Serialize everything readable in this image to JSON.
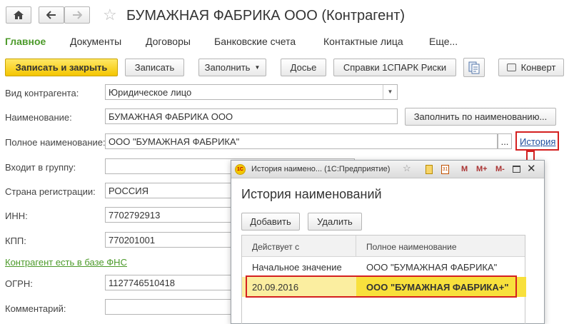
{
  "titlebar": {
    "title": "БУМАЖНАЯ ФАБРИКА ООО (Контрагент)"
  },
  "menu": {
    "items": [
      "Главное",
      "Документы",
      "Договоры",
      "Банковские счета",
      "Контактные лица",
      "Еще..."
    ]
  },
  "toolbar": {
    "save_close": "Записать и закрыть",
    "save": "Записать",
    "fill": "Заполнить",
    "dossier": "Досье",
    "spark": "Справки 1СПАРК Риски",
    "envelope": "Конверт"
  },
  "form": {
    "type_label": "Вид контрагента:",
    "type_value": "Юридическое лицо",
    "name_label": "Наименование:",
    "name_value": "БУМАЖНАЯ ФАБРИКА ООО",
    "fill_by_name": "Заполнить по наименованию...",
    "full_name_label": "Полное наименование:",
    "full_name_value": "ООО \"БУМАЖНАЯ ФАБРИКА\"",
    "ellipsis": "...",
    "history_link": "История",
    "group_label": "Входит в группу:",
    "group_value": "",
    "country_label": "Страна регистрации:",
    "country_value": "РОССИЯ",
    "inn_label": "ИНН:",
    "inn_value": "7702792913",
    "kpp_label": "КПП:",
    "kpp_value": "770201001",
    "fns_link": "Контрагент есть в базе ФНС",
    "ogrn_label": "ОГРН:",
    "ogrn_value": "1127746510418",
    "comment_label": "Комментарий:",
    "comment_value": ""
  },
  "popup": {
    "window_title": "История наимено... (1С:Предприятие)",
    "heading": "История наименований",
    "add": "Добавить",
    "delete": "Удалить",
    "btn_m": "M",
    "btn_mplus": "M+",
    "btn_mminus": "M-",
    "columns": [
      "Действует с",
      "Полное наименование"
    ],
    "rows": [
      {
        "date": "Начальное значение",
        "name": "ООО \"БУМАЖНАЯ ФАБРИКА\""
      },
      {
        "date": "20.09.2016",
        "name": "ООО \"БУМАЖНАЯ ФАБРИКА+\""
      }
    ]
  },
  "colors": {
    "accent_green": "#4c9a2a",
    "highlight_yellow": "#f8e03c",
    "annotation_red": "#d42020",
    "primary_button": "#f4c500"
  }
}
